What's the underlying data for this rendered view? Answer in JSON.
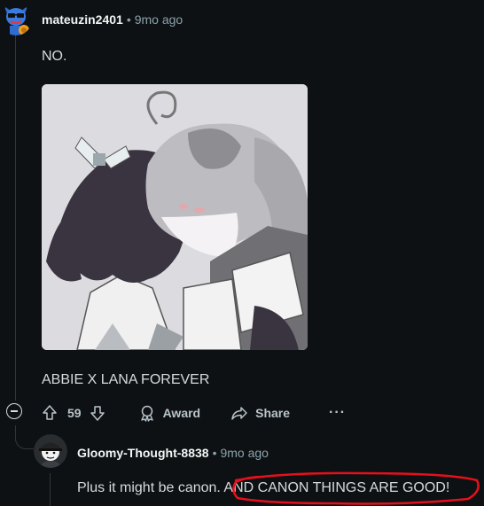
{
  "comment": {
    "username": "mateuzin2401",
    "separator": "•",
    "time": "9mo ago",
    "body": "NO.",
    "caption": "ABBIE X LANA FOREVER",
    "vote_count": "59",
    "award_label": "Award",
    "share_label": "Share",
    "more_label": "···"
  },
  "reply": {
    "username": "Gloomy-Thought-8838",
    "separator": "•",
    "time": "9mo ago",
    "text": "Plus it might be canon. AND CANON THINGS ARE GOOD!"
  },
  "colors": {
    "background": "#0e1113",
    "text": "#d7dadc",
    "meta": "#8ba2ad",
    "highlight_circle": "#e5101c"
  },
  "icons": {
    "upvote": "arrow-up-icon",
    "downvote": "arrow-down-icon",
    "award": "award-icon",
    "share": "share-icon",
    "collapse": "minus-circle-icon"
  }
}
